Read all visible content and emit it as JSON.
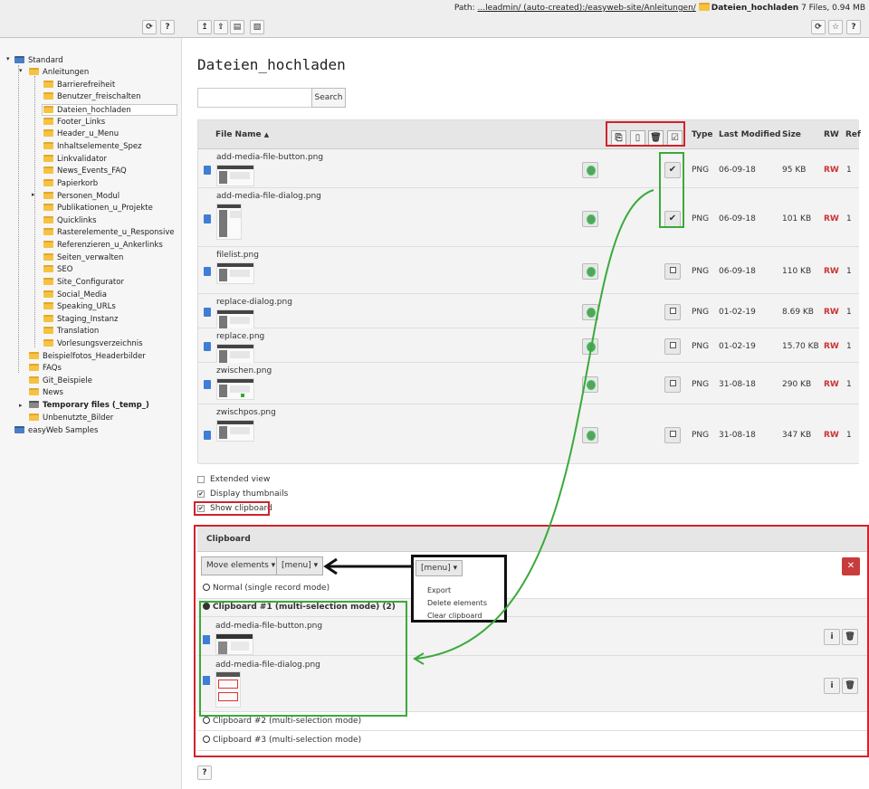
{
  "path": {
    "label": "Path:",
    "link": "...leadmin/ (auto-created):/easyweb-site/Anleitungen/",
    "current": "Dateien_hochladen",
    "info": "7 Files, 0.94 MB"
  },
  "toolbar": {
    "refresh": "⟳",
    "help": "?",
    "star": "☆"
  },
  "tree": {
    "items": [
      {
        "label": "Standard"
      },
      {
        "label": "Anleitungen"
      },
      {
        "label": "Barrierefreiheit"
      },
      {
        "label": "Benutzer_freischalten"
      },
      {
        "label": "Dateien_hochladen"
      },
      {
        "label": "Footer_Links"
      },
      {
        "label": "Header_u_Menu"
      },
      {
        "label": "Inhaltselemente_Spez"
      },
      {
        "label": "Linkvalidator"
      },
      {
        "label": "News_Events_FAQ"
      },
      {
        "label": "Papierkorb"
      },
      {
        "label": "Personen_Modul"
      },
      {
        "label": "Publikationen_u_Projekte"
      },
      {
        "label": "Quicklinks"
      },
      {
        "label": "Rasterelemente_u_Responsive"
      },
      {
        "label": "Referenzieren_u_Ankerlinks"
      },
      {
        "label": "Seiten_verwalten"
      },
      {
        "label": "SEO"
      },
      {
        "label": "Site_Configurator"
      },
      {
        "label": "Social_Media"
      },
      {
        "label": "Speaking_URLs"
      },
      {
        "label": "Staging_Instanz"
      },
      {
        "label": "Translation"
      },
      {
        "label": "Vorlesungsverzeichnis"
      },
      {
        "label": "Beispielfotos_Headerbilder"
      },
      {
        "label": "FAQs"
      },
      {
        "label": "Git_Beispiele"
      },
      {
        "label": "News"
      },
      {
        "label": "Temporary files (_temp_)"
      },
      {
        "label": "Unbenutzte_Bilder"
      },
      {
        "label": "easyWeb Samples"
      }
    ]
  },
  "main": {
    "title": "Dateien_hochladen",
    "search_label": "Search"
  },
  "table": {
    "headers": {
      "name": "File Name",
      "sort": "▲",
      "type": "Type",
      "modified": "Last Modified",
      "size": "Size",
      "rw": "RW",
      "ref": "Ref"
    },
    "rows": [
      {
        "name": "add-media-file-button.png",
        "type": "PNG",
        "modified": "06-09-18",
        "size": "95 KB",
        "rw": "RW",
        "ref": "1",
        "checked": "✔"
      },
      {
        "name": "add-media-file-dialog.png",
        "type": "PNG",
        "modified": "06-09-18",
        "size": "101 KB",
        "rw": "RW",
        "ref": "1",
        "checked": "✔"
      },
      {
        "name": "filelist.png",
        "type": "PNG",
        "modified": "06-09-18",
        "size": "110 KB",
        "rw": "RW",
        "ref": "1",
        "checked": ""
      },
      {
        "name": "replace-dialog.png",
        "type": "PNG",
        "modified": "01-02-19",
        "size": "8.69 KB",
        "rw": "RW",
        "ref": "1",
        "checked": ""
      },
      {
        "name": "replace.png",
        "type": "PNG",
        "modified": "01-02-19",
        "size": "15.70 KB",
        "rw": "RW",
        "ref": "1",
        "checked": ""
      },
      {
        "name": "zwischen.png",
        "type": "PNG",
        "modified": "31-08-18",
        "size": "290 KB",
        "rw": "RW",
        "ref": "1",
        "checked": ""
      },
      {
        "name": "zwischpos.png",
        "type": "PNG",
        "modified": "31-08-18",
        "size": "347 KB",
        "rw": "RW",
        "ref": "1",
        "checked": ""
      }
    ]
  },
  "options": {
    "extended": "Extended view",
    "thumbs": "Display thumbnails",
    "clipboard": "Show clipboard",
    "check": "✔"
  },
  "clipboard": {
    "title": "Clipboard",
    "move": "Move elements ▾",
    "menu": "[menu] ▾",
    "close": "✕",
    "normal": "Normal (single record mode)",
    "pad1": "Clipboard #1 (multi-selection mode) (2)",
    "pad1_items": [
      "add-media-file-button.png",
      "add-media-file-dialog.png"
    ],
    "pad2": "Clipboard #2 (multi-selection mode)",
    "pad3": "Clipboard #3 (multi-selection mode)",
    "info": "i",
    "trash": "🗑"
  },
  "menu_popup": {
    "title": "[menu] ▾",
    "items": [
      "Export",
      "Delete elements",
      "Clear clipboard"
    ]
  },
  "footer_help": "?"
}
